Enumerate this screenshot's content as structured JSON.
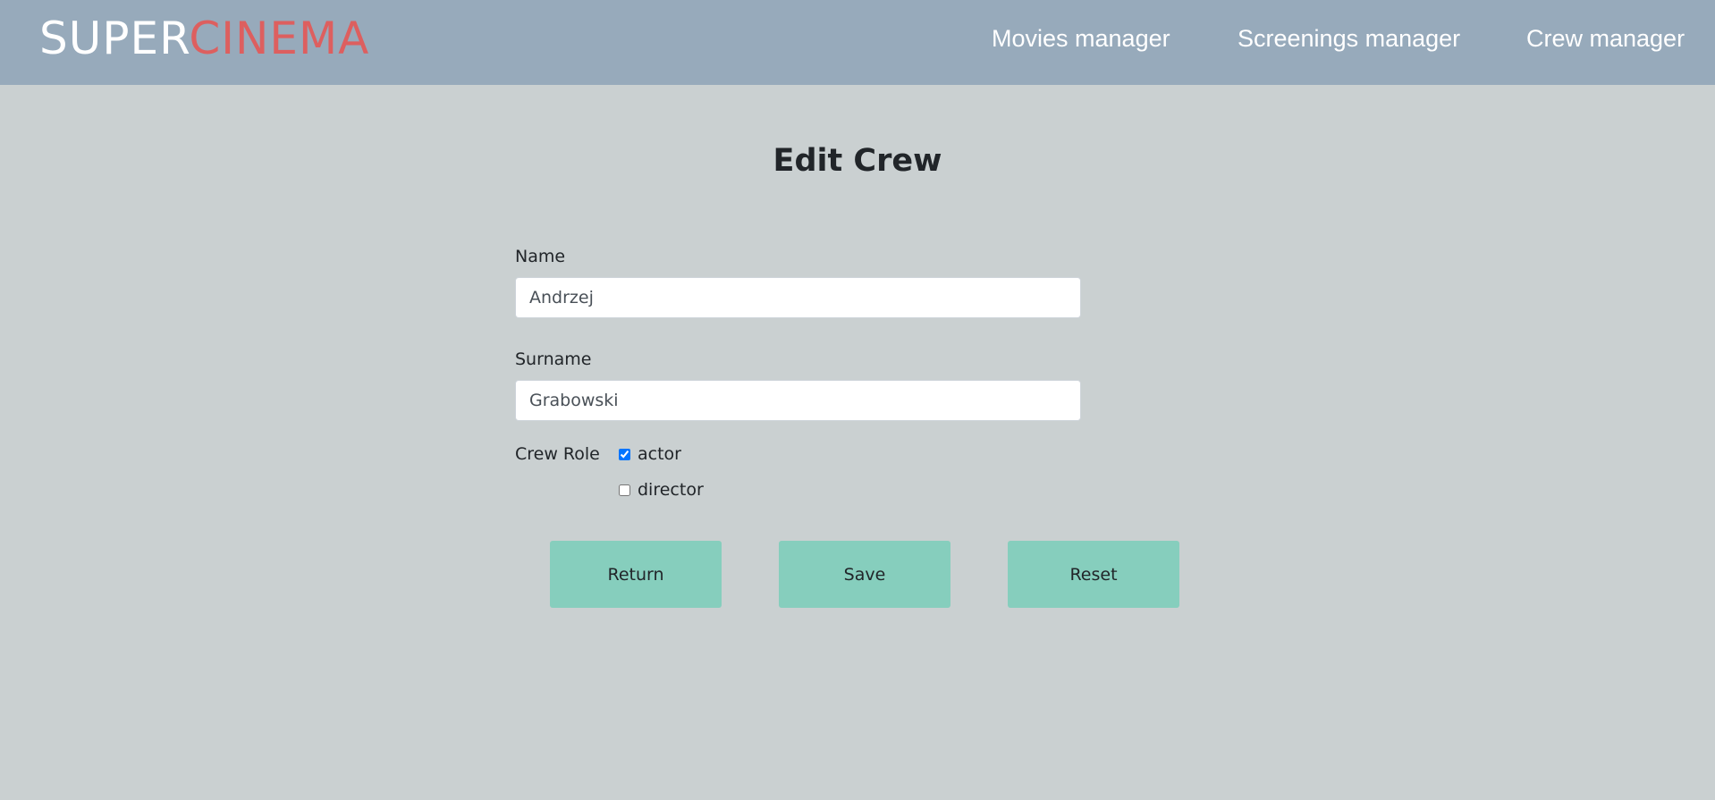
{
  "header": {
    "logo_part1": "SUPER",
    "logo_part2": "CINEMA",
    "nav": {
      "movies": "Movies manager",
      "screenings": "Screenings manager",
      "crew": "Crew manager"
    }
  },
  "form": {
    "title": "Edit Crew",
    "name_label": "Name",
    "name_value": "Andrzej",
    "surname_label": "Surname",
    "surname_value": "Grabowski",
    "role_label": "Crew Role",
    "roles": [
      {
        "label": "actor",
        "checked": true
      },
      {
        "label": "director",
        "checked": false
      }
    ],
    "buttons": {
      "return": "Return",
      "save": "Save",
      "reset": "Reset"
    }
  },
  "colors": {
    "navbar_bg": "#97aabb",
    "page_bg": "#cad0d1",
    "logo_accent": "#dd5f5f",
    "button_bg": "#86cebd"
  }
}
